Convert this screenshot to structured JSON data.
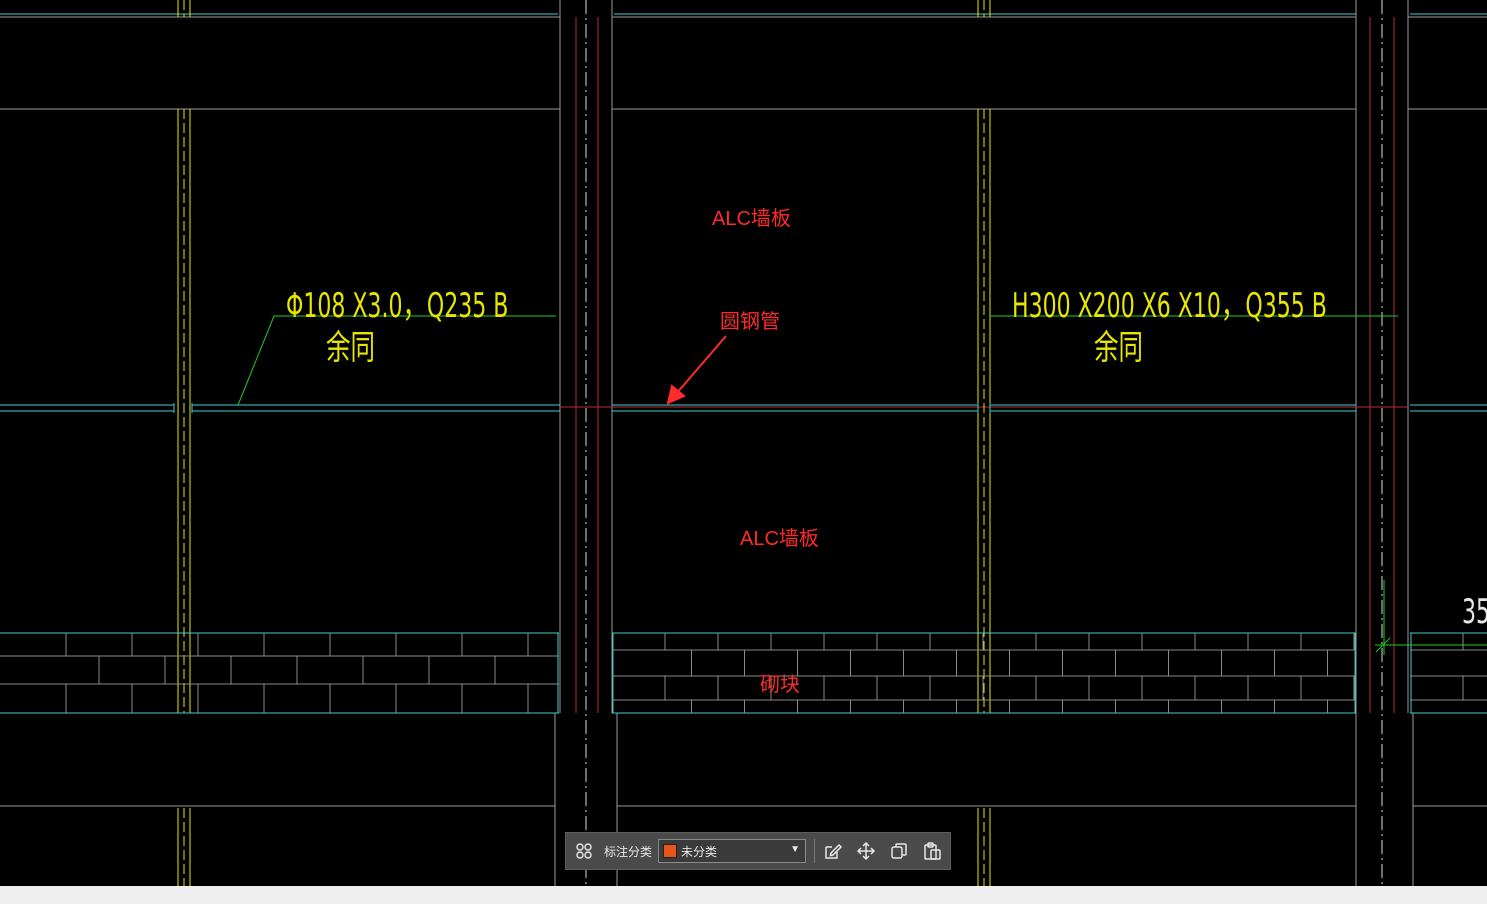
{
  "annotations": {
    "alc_top": "ALC墙板",
    "tube": "圆钢管",
    "alc_bottom": "ALC墙板",
    "block": "砌块"
  },
  "cad_labels": {
    "left_spec": "Φ108 X3.0，Q235 B",
    "left_note": "余同",
    "right_spec": "H300 X200 X6 X10，Q355 B",
    "right_note": "余同",
    "edge_partial": "35"
  },
  "toolbar": {
    "category_label": "标注分类",
    "selected_category": "未分类",
    "selected_color": "#e8541c"
  },
  "colors": {
    "cyan": "#3fd0d0",
    "yellow": "#e6e600",
    "green": "#22cc22",
    "red_annotation": "#ff2a2a",
    "beam_gray": "#9a9a9a"
  }
}
